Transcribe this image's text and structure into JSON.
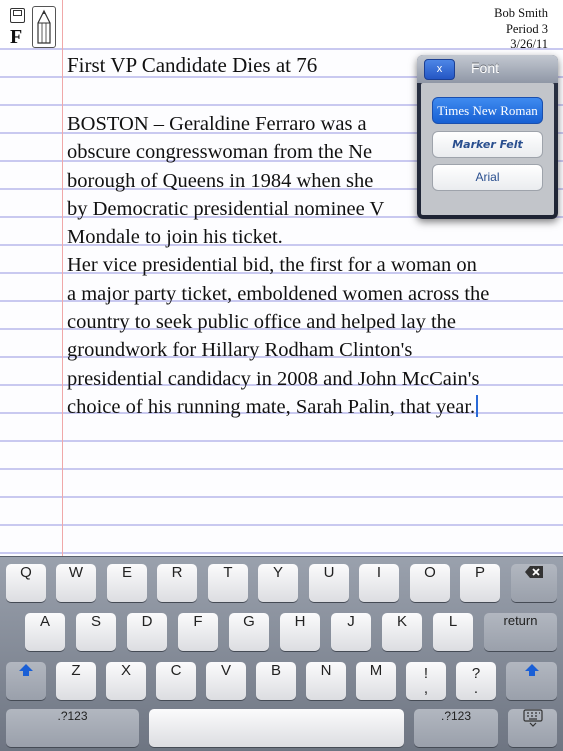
{
  "toolbar": {
    "save_icon": "floppy-disk-icon",
    "font_label": "F",
    "pencil_icon": "pencil-icon"
  },
  "header": {
    "name": "Bob Smith",
    "period": "Period 3",
    "date": "3/26/11"
  },
  "document": {
    "title": "First VP Candidate Dies at 76",
    "body": "BOSTON – Geraldine Ferraro was a\nobscure congresswoman from the Ne\nborough of Queens in 1984 when she\nby Democratic presidential nominee V\nMondale to join his ticket.\nHer vice presidential bid, the first for a woman on\na major party ticket, emboldened women across the\ncountry to seek public office and helped lay the\ngroundwork for Hillary Rodham Clinton's\npresidential candidacy in 2008 and John McCain's\nchoice of his running mate, Sarah Palin, that year."
  },
  "font_popover": {
    "close_label": "x",
    "title": "Font",
    "options": [
      "Times New Roman",
      "Marker Felt",
      "Arial"
    ],
    "selected": "Times New Roman"
  },
  "keyboard": {
    "row1": [
      "Q",
      "W",
      "E",
      "R",
      "T",
      "Y",
      "U",
      "I",
      "O",
      "P"
    ],
    "backspace_icon": "backspace-icon",
    "row2": [
      "A",
      "S",
      "D",
      "F",
      "G",
      "H",
      "J",
      "K",
      "L"
    ],
    "return_label": "return",
    "shift_icon": "shift-arrow-icon",
    "row3": [
      "Z",
      "X",
      "C",
      "V",
      "B",
      "N",
      "M"
    ],
    "punct1": "!\n,",
    "punct2": "?\n.",
    "numbers_label": ".?123",
    "hide_keyboard_icon": "keyboard-dismiss-icon"
  },
  "colors": {
    "rule_line": "#c9c9f0",
    "margin_line": "#f0a8a8",
    "selected_font": "#1760d3",
    "cursor": "#2a6ad8"
  }
}
